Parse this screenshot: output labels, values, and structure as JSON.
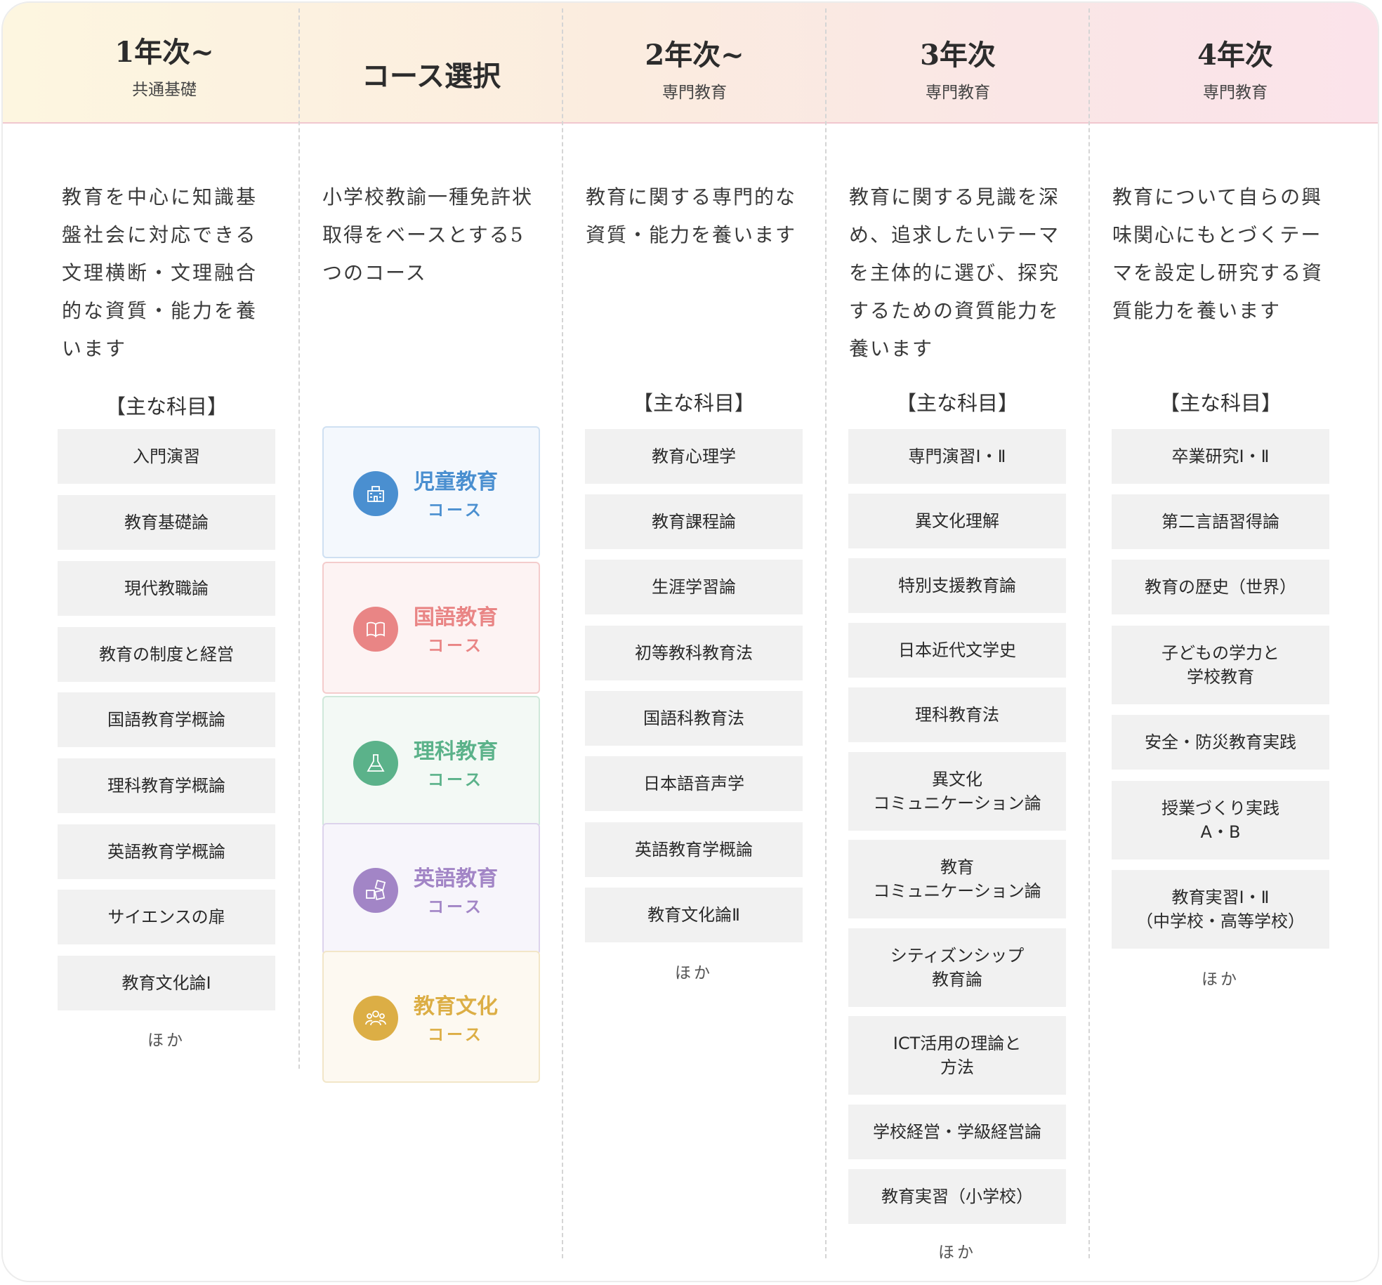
{
  "header": {
    "col1": {
      "title": "1年次~",
      "sub": "共通基礎"
    },
    "col2": {
      "title": "コース選択"
    },
    "col3": {
      "title": "2年次~",
      "sub": "専門教育"
    },
    "col4": {
      "title": "3年次",
      "sub": "専門教育"
    },
    "col5": {
      "title": "4年次",
      "sub": "専門教育"
    }
  },
  "columns": {
    "col1": {
      "desc": [
        "教育を中心に知識基",
        "盤社会に対応できる",
        "文理横断・文理融合",
        "的な資質・能力を養",
        "います"
      ],
      "subj_head": "【主な科目】",
      "subjects": [
        "入門演習",
        "教育基礎論",
        "現代教職論",
        "教育の制度と経営",
        "国語教育学概論",
        "理科教育学概論",
        "英語教育学概論",
        "サイエンスの扉",
        "教育文化論Ⅰ"
      ],
      "more": "ほか"
    },
    "col2": {
      "desc": [
        "小学校教諭一種免許状",
        "取得をベースとする5",
        "つのコース"
      ],
      "courses": [
        {
          "name": "児童教育",
          "kind": "コース",
          "icon": "school-building-icon",
          "color": "#4a8fd0"
        },
        {
          "name": "国語教育",
          "kind": "コース",
          "icon": "open-book-icon",
          "color": "#e98585"
        },
        {
          "name": "理科教育",
          "kind": "コース",
          "icon": "flask-icon",
          "color": "#5bb28a"
        },
        {
          "name": "英語教育",
          "kind": "コース",
          "icon": "letter-blocks-icon",
          "color": "#a285c6"
        },
        {
          "name": "教育文化",
          "kind": "コース",
          "icon": "people-group-icon",
          "color": "#dcae45"
        }
      ]
    },
    "col3": {
      "desc": [
        "教育に関する専門的な",
        "資質・能力を養います"
      ],
      "subj_head": "【主な科目】",
      "subjects": [
        "教育心理学",
        "教育課程論",
        "生涯学習論",
        "初等教科教育法",
        "国語科教育法",
        "日本語音声学",
        "英語教育学概論",
        "教育文化論Ⅱ"
      ],
      "more": "ほか"
    },
    "col4": {
      "desc": [
        "教育に関する見識を深",
        "め、追求したいテーマ",
        "を主体的に選び、探究",
        "するための資質能力を",
        "養います"
      ],
      "subj_head": "【主な科目】",
      "subjects": [
        "専門演習Ⅰ・Ⅱ",
        "異文化理解",
        "特別支援教育論",
        "日本近代文学史",
        "理科教育法",
        "異文化\nコミュニケーション論",
        "教育\nコミュニケーション論",
        "シティズンシップ\n教育論",
        "ICT活用の理論と\n方法",
        "学校経営・学級経営論",
        "教育実習（小学校）"
      ],
      "more": "ほか"
    },
    "col5": {
      "desc": [
        "教育について自らの興",
        "味関心にもとづくテー",
        "マを設定し研究する資",
        "質能力を養います"
      ],
      "subj_head": "【主な科目】",
      "subjects": [
        "卒業研究Ⅰ・Ⅱ",
        "第二言語習得論",
        "教育の歴史（世界）",
        "子どもの学力と\n学校教育",
        "安全・防災教育実践",
        "授業づくり実践\nA・B",
        "教育実習Ⅰ・Ⅱ\n（中学校・高等学校）"
      ],
      "more": "ほか"
    }
  }
}
